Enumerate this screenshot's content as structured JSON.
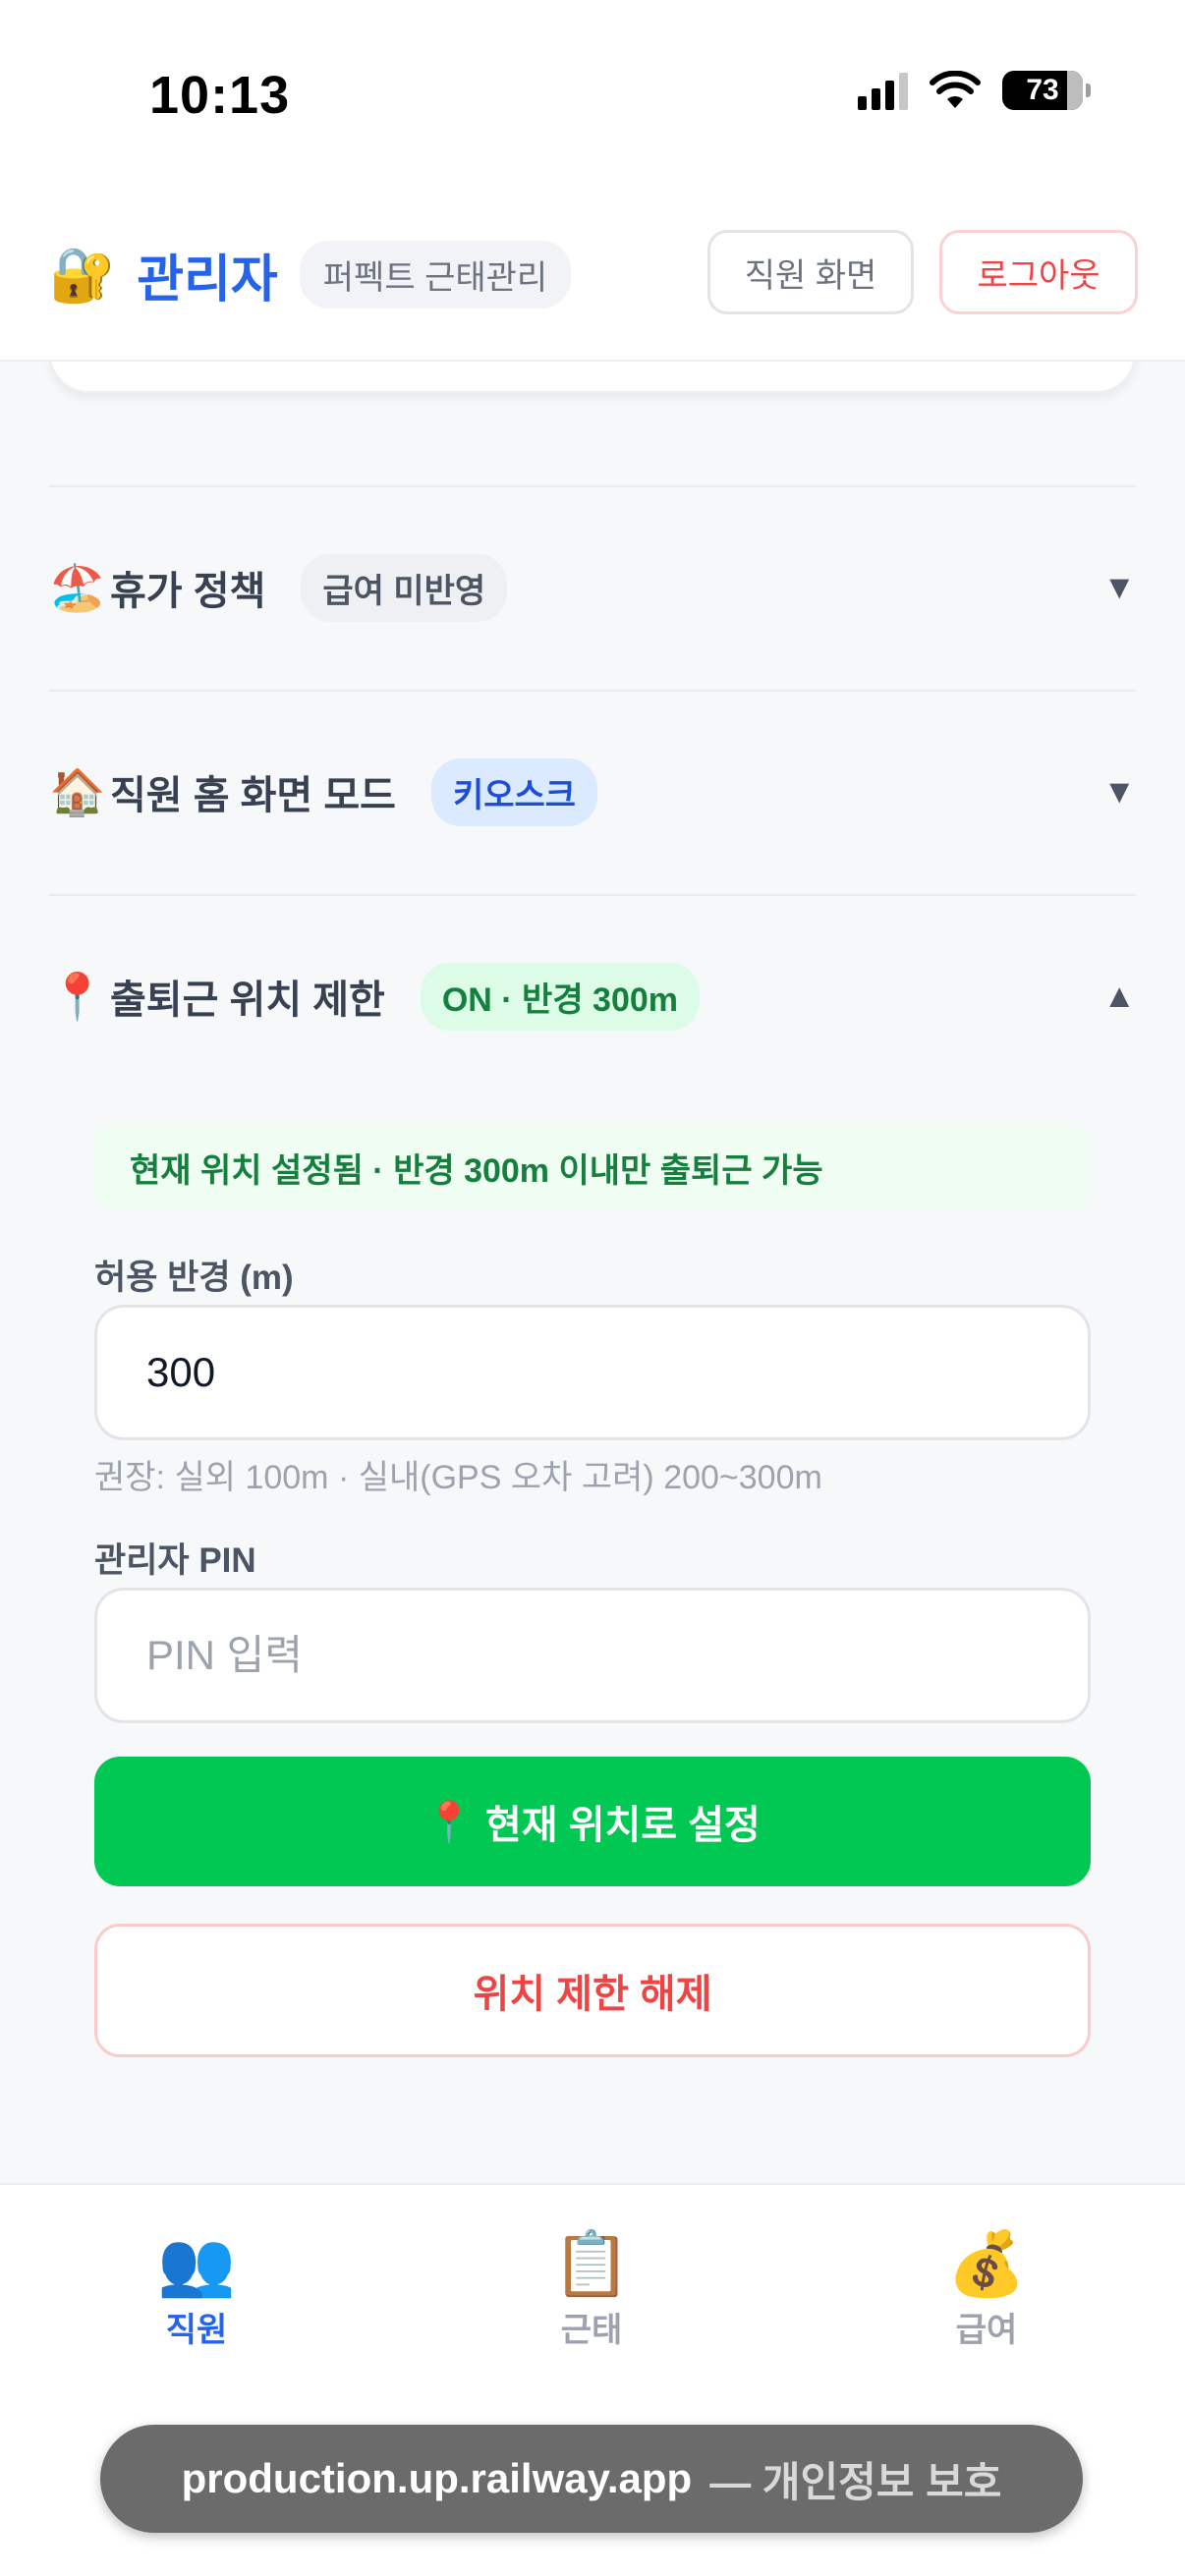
{
  "status_bar": {
    "time": "10:13",
    "battery": "73"
  },
  "header": {
    "title": "관리자",
    "app_badge": "퍼펙트 근태관리",
    "employee_view_label": "직원 화면",
    "logout_label": "로그아웃",
    "title_icon": "lock-with-key-icon"
  },
  "sections": {
    "vacation": {
      "title": "휴가 정책",
      "badge": "급여 미반영",
      "icon": "beach-umbrella-icon",
      "expanded": false
    },
    "home_mode": {
      "title": "직원 홈 화면 모드",
      "badge": "키오스크",
      "icon": "house-icon",
      "expanded": false
    },
    "location": {
      "title": "출퇴근 위치 제한",
      "badge": "ON · 반경 300m",
      "icon": "round-pushpin-icon",
      "expanded": true,
      "notice": "현재 위치 설정됨 · 반경 300m 이내만 출퇴근 가능",
      "radius_label": "허용 반경 (m)",
      "radius_value": "300",
      "hint": "권장: 실외 100m · 실내(GPS 오차 고려) 200~300m",
      "pin_label": "관리자 PIN",
      "pin_placeholder": "PIN 입력",
      "set_button_label": "현재 위치로 설정",
      "clear_button_label": "위치 제한 해제"
    }
  },
  "bottom_nav": {
    "items": [
      {
        "label": "직원",
        "icon": "people-icon",
        "active": true
      },
      {
        "label": "근태",
        "icon": "clipboard-icon",
        "active": false
      },
      {
        "label": "급여",
        "icon": "money-bag-icon",
        "active": false
      }
    ]
  },
  "browser": {
    "url": "production.up.railway.app",
    "privacy_label": "— 개인정보 보호"
  },
  "colors": {
    "accent": "#2563eb",
    "primary_green": "#00c853",
    "danger": "#ef4444"
  }
}
